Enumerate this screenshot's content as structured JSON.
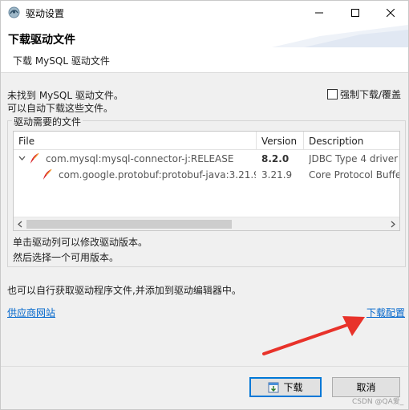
{
  "window": {
    "title": "驱动设置",
    "accent_color": "#0078d7"
  },
  "banner": {
    "title": "下载驱动文件",
    "subtitle": "下载 MySQL 驱动文件"
  },
  "messages": {
    "line1": "未找到 MySQL 驱动文件。",
    "line2": "可以自动下载这些文件。",
    "force_label": "强制下载/覆盖",
    "force_checked": false
  },
  "group": {
    "legend": "驱动需要的文件",
    "columns": [
      "File",
      "Version",
      "Description"
    ],
    "rows": [
      {
        "file": "com.mysql:mysql-connector-j:RELEASE",
        "version": "8.2.0",
        "description": "JDBC Type 4 driver",
        "expanded": true
      },
      {
        "file": "com.google.protobuf:protobuf-java:3.21.9",
        "version": "3.21.9",
        "description": "Core Protocol Buffe"
      }
    ],
    "hint1": "单击驱动列可以修改驱动版本。",
    "hint2": "然后选择一个可用版本。"
  },
  "info_text": "也可以自行获取驱动程序文件,并添加到驱动编辑器中。",
  "links": {
    "vendor_site": "供应商网站",
    "download_config": "下载配置"
  },
  "buttons": {
    "download": "下载",
    "cancel": "取消"
  },
  "annotation_color": "#e8322a",
  "watermark": "CSDN @QA爱_"
}
